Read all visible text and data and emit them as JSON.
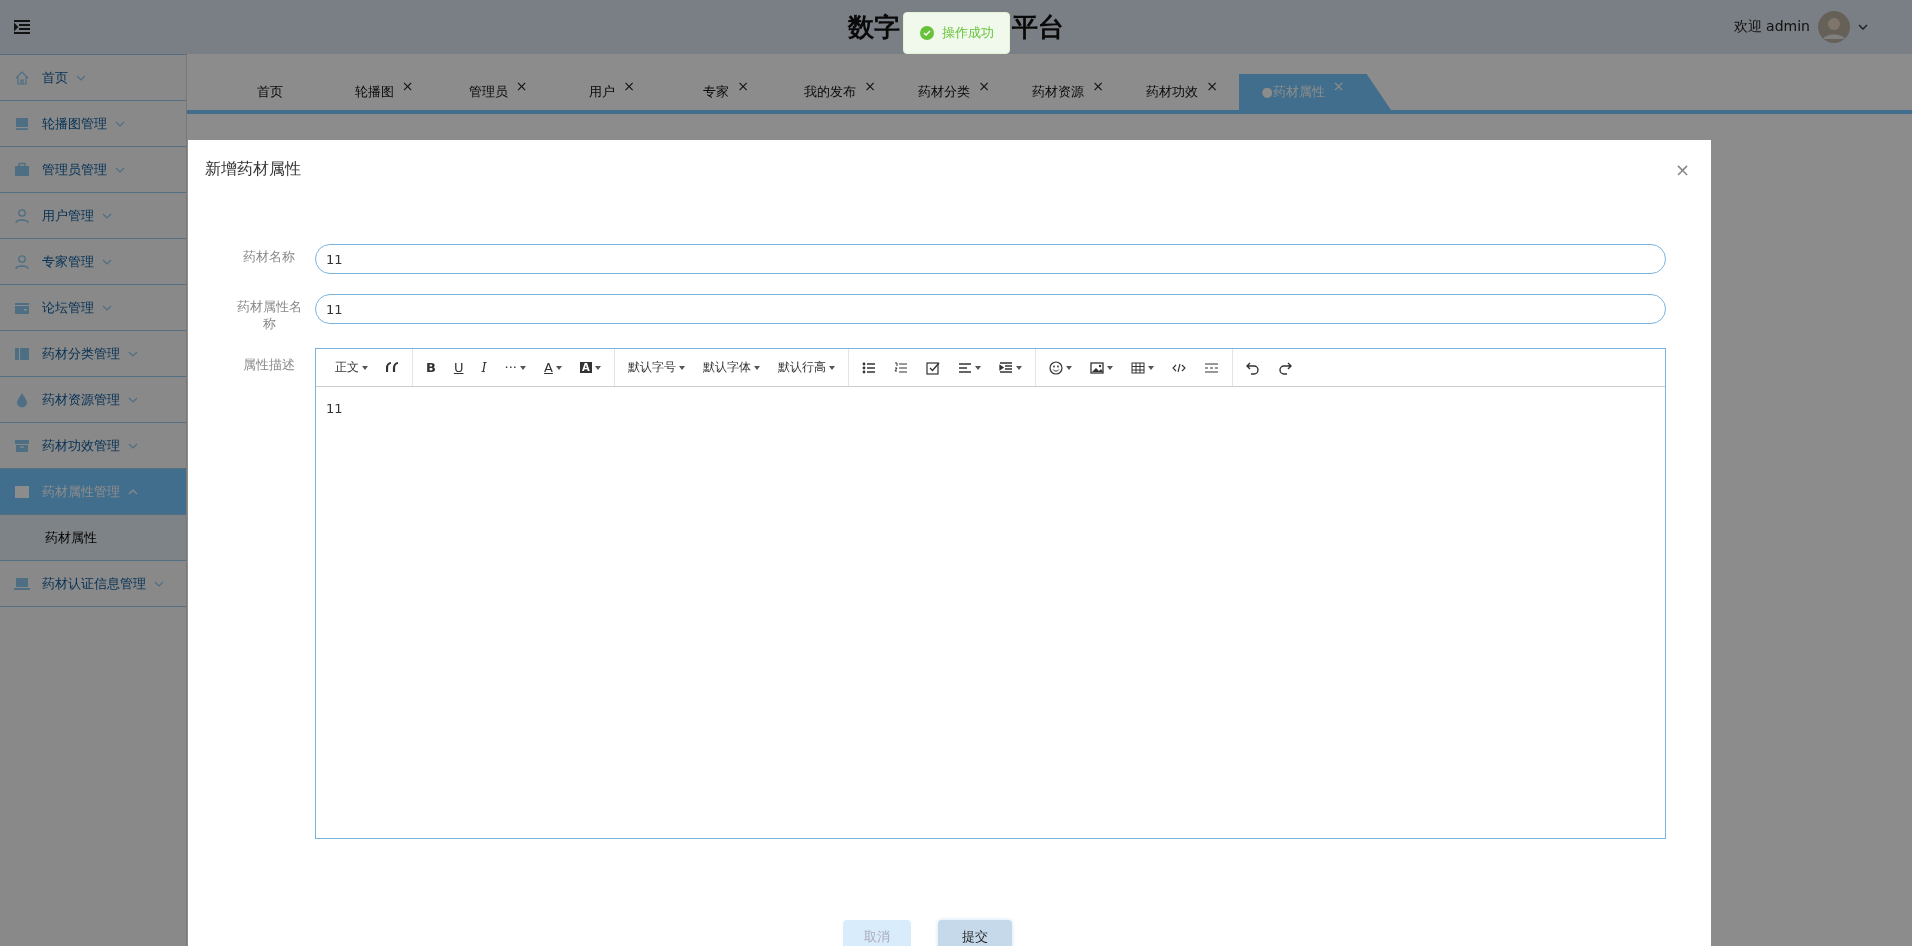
{
  "header": {
    "title_parts": [
      "数字",
      "平台"
    ],
    "welcome": "欢迎 admin"
  },
  "toast": {
    "message": "操作成功"
  },
  "sidebar": {
    "items": [
      {
        "label": "首页",
        "expanded": false,
        "selected": false
      },
      {
        "label": "轮播图管理",
        "expanded": false,
        "selected": false
      },
      {
        "label": "管理员管理",
        "expanded": false,
        "selected": false
      },
      {
        "label": "用户管理",
        "expanded": false,
        "selected": false
      },
      {
        "label": "专家管理",
        "expanded": false,
        "selected": false
      },
      {
        "label": "论坛管理",
        "expanded": false,
        "selected": false
      },
      {
        "label": "药材分类管理",
        "expanded": false,
        "selected": false
      },
      {
        "label": "药材资源管理",
        "expanded": false,
        "selected": false
      },
      {
        "label": "药材功效管理",
        "expanded": false,
        "selected": false
      },
      {
        "label": "药材属性管理",
        "expanded": true,
        "selected": true,
        "children": [
          {
            "label": "药材属性",
            "selected": true
          }
        ]
      },
      {
        "label": "药材认证信息管理",
        "expanded": false,
        "selected": false
      }
    ]
  },
  "tabs": [
    {
      "label": "首页",
      "selected": false
    },
    {
      "label": "轮播图",
      "close": "×",
      "selected": false
    },
    {
      "label": "管理员",
      "close": "×",
      "selected": false
    },
    {
      "label": "用户",
      "close": "×",
      "selected": false
    },
    {
      "label": "专家",
      "close": "×",
      "selected": false
    },
    {
      "label": "我的发布",
      "close": "×",
      "selected": false
    },
    {
      "label": "药材分类",
      "close": "×",
      "selected": false
    },
    {
      "label": "药材资源",
      "close": "×",
      "selected": false
    },
    {
      "label": "药材功效",
      "close": "×",
      "selected": false
    },
    {
      "label": "●药材属性",
      "close": "×",
      "selected": true
    }
  ],
  "dialog": {
    "title": "新增药材属性",
    "close": "×",
    "fields": [
      {
        "label": "药材名称",
        "value": "11"
      },
      {
        "label": "药材属性名称",
        "value": "11"
      }
    ],
    "editor": {
      "label": "属性描述",
      "content": "11",
      "toolbar": [
        [
          {
            "kind": "select",
            "label": "正文"
          },
          {
            "kind": "icon"
          }
        ],
        [
          {
            "kind": "bold",
            "label": "B"
          },
          {
            "kind": "underline",
            "label": "U"
          },
          {
            "kind": "italic",
            "label": "I"
          },
          {
            "kind": "more",
            "label": "···",
            "dropdown": true
          },
          {
            "kind": "fontcolor",
            "label": "A",
            "dropdown": true
          },
          {
            "kind": "bgcolor",
            "label": "A",
            "dropdown": true
          }
        ],
        [
          {
            "kind": "select",
            "label": "默认字号"
          },
          {
            "kind": "select",
            "label": "默认字体"
          },
          {
            "kind": "select",
            "label": "默认行高"
          }
        ],
        [
          {
            "kind": "icon"
          },
          {
            "kind": "icon"
          },
          {
            "kind": "icon"
          },
          {
            "kind": "icon",
            "dropdown": true
          },
          {
            "kind": "icon",
            "dropdown": true
          }
        ],
        [
          {
            "kind": "icon",
            "dropdown": true
          },
          {
            "kind": "icon",
            "dropdown": true
          },
          {
            "kind": "icon",
            "dropdown": true
          },
          {
            "kind": "icon"
          },
          {
            "kind": "icon"
          }
        ],
        [
          {
            "kind": "icon"
          },
          {
            "kind": "icon"
          }
        ]
      ]
    },
    "buttons": [
      {
        "label": "取消",
        "kind": "cancel"
      },
      {
        "label": "提交",
        "kind": "submit"
      }
    ]
  }
}
